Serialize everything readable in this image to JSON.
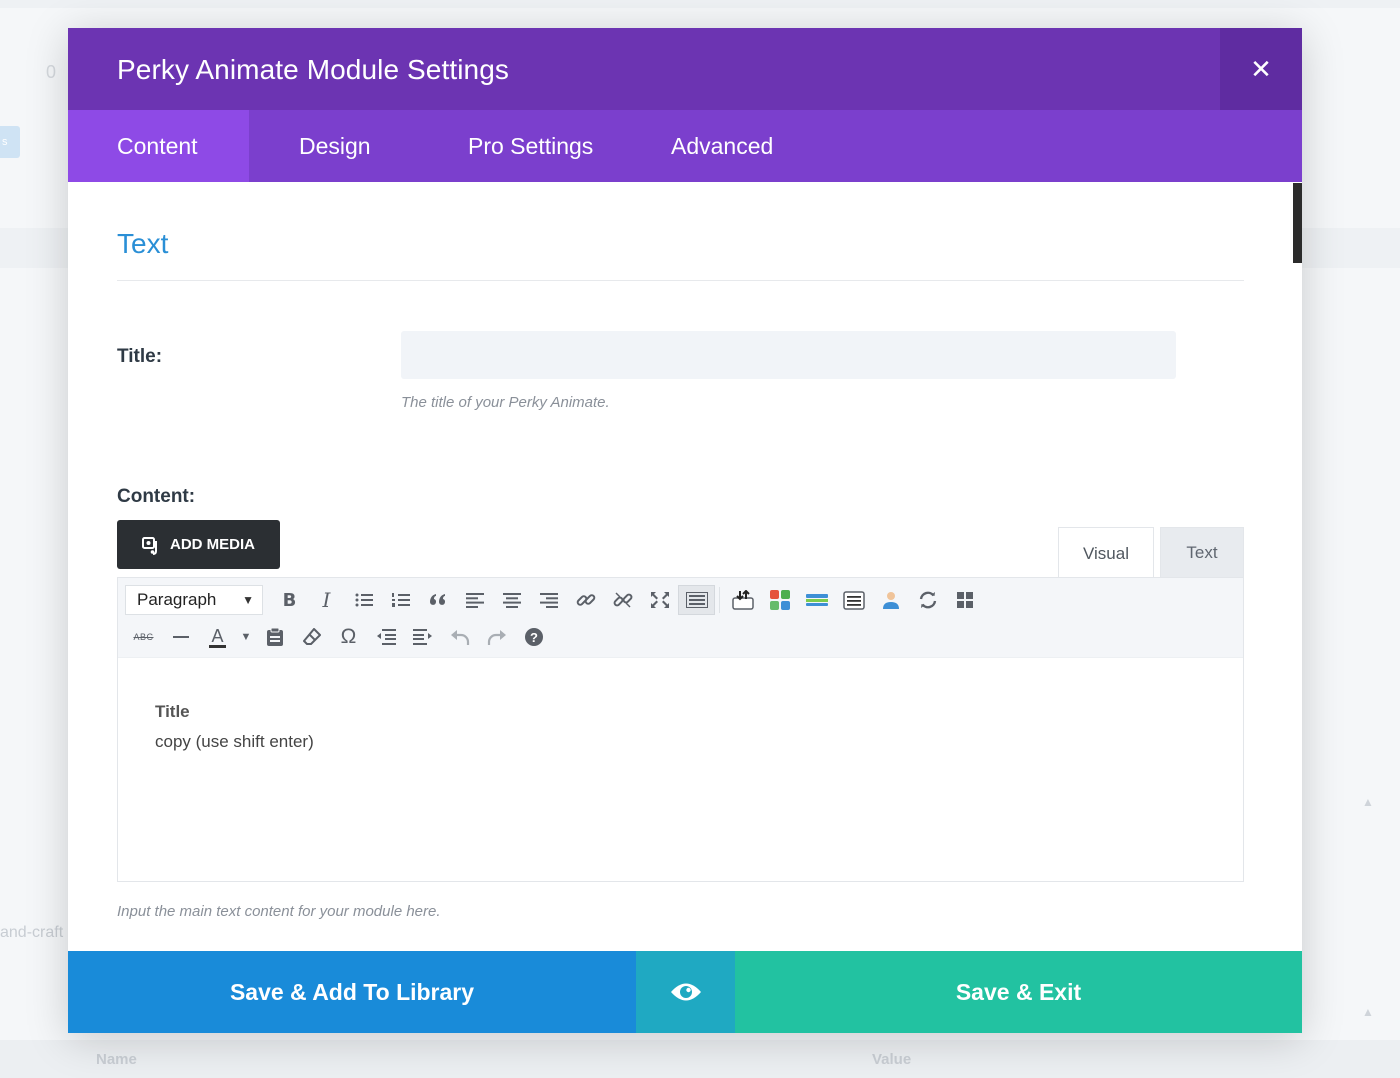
{
  "background": {
    "zero": "0",
    "chip": "s",
    "slug": "and-craft",
    "footer_name": "Name",
    "footer_value": "Value"
  },
  "modal": {
    "title": "Perky Animate Module Settings",
    "close_glyph": "✕"
  },
  "tabs": [
    {
      "label": "Content",
      "active": true
    },
    {
      "label": "Design",
      "active": false
    },
    {
      "label": "Pro Settings",
      "active": false
    },
    {
      "label": "Advanced",
      "active": false
    }
  ],
  "section": {
    "title": "Text"
  },
  "fields": {
    "title_label": "Title:",
    "title_value": "",
    "title_hint": "The title of your Perky Animate.",
    "content_label": "Content:",
    "content_hint": "Input the main text content for your module here."
  },
  "editor": {
    "add_media_label": "ADD MEDIA",
    "tab_visual": "Visual",
    "tab_text": "Text",
    "format_select": "Paragraph",
    "strikethrough_glyph": "ABC",
    "textcolor_glyph": "A",
    "omega_glyph": "Ω",
    "help_glyph": "?",
    "body_title": "Title",
    "body_copy": "copy (use shift enter)"
  },
  "footer": {
    "save_library_label": "Save & Add To Library",
    "save_exit_label": "Save & Exit"
  },
  "colors": {
    "header": "#6c34b2",
    "tabs": "#7b3fcd",
    "active_tab": "#8e4ae6",
    "section_title": "#2a8fd6",
    "save_library": "#198bd9",
    "preview": "#1fa9c2",
    "save_exit": "#22c2a1"
  }
}
